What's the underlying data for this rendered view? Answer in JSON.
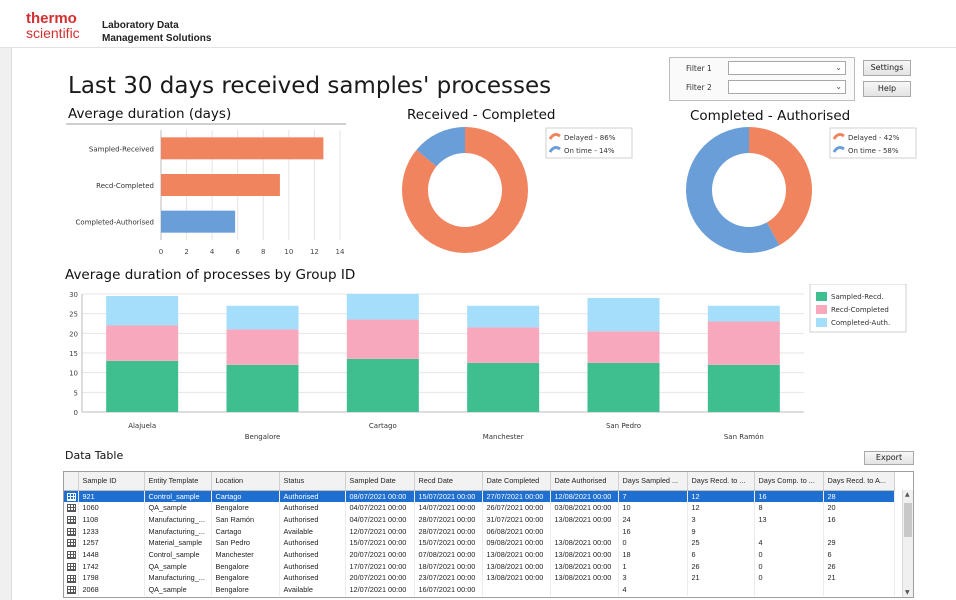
{
  "header": {
    "logo_line1": "thermo",
    "logo_line2": "scientific",
    "app_line1": "Laboratory Data",
    "app_line2": "Management Solutions"
  },
  "page_title": "Last 30 days received samples' processes",
  "filters": {
    "filter1_label": "Filter 1",
    "filter1_value": "",
    "filter2_label": "Filter 2",
    "filter2_value": "",
    "settings_label": "Settings",
    "help_label": "Help"
  },
  "colors": {
    "orange": "#f0845e",
    "blue": "#6a9ed8",
    "green": "#3fbf8f",
    "pink": "#f8a8bc",
    "lightblue": "#a4defa",
    "selection": "#1f6fd1"
  },
  "chart_data": [
    {
      "type": "bar",
      "orientation": "horizontal",
      "title": "Average duration (days)",
      "categories": [
        "Sampled-Received",
        "Recd-Completed",
        "Completed-Authorised"
      ],
      "values": [
        12.7,
        9.3,
        5.8
      ],
      "colors": [
        "#f0845e",
        "#f0845e",
        "#6a9ed8"
      ],
      "xlim": [
        0,
        14
      ],
      "xticks": [
        "0",
        "2",
        "4",
        "6",
        "8",
        "10",
        "12",
        "14"
      ],
      "grid": true
    },
    {
      "type": "pie",
      "style": "donut",
      "title": "Received - Completed",
      "slices": [
        {
          "label": "Delayed - 86%",
          "value": 86,
          "color": "#f0845e"
        },
        {
          "label": "On time - 14%",
          "value": 14,
          "color": "#6a9ed8"
        }
      ],
      "legend": "top-right"
    },
    {
      "type": "pie",
      "style": "donut",
      "title": "Completed - Authorised",
      "slices": [
        {
          "label": "Delayed - 42%",
          "value": 42,
          "color": "#f0845e"
        },
        {
          "label": "On time - 58%",
          "value": 58,
          "color": "#6a9ed8"
        }
      ],
      "legend": "top-right"
    },
    {
      "type": "bar",
      "stacked": true,
      "title": "Average duration of processes by Group ID",
      "categories": [
        "Alajuela",
        "Bengalore",
        "Cartago",
        "Manchester",
        "San Pedro",
        "San Ramón"
      ],
      "series": [
        {
          "name": "Sampled-Recd.",
          "values": [
            13,
            12,
            13.5,
            12.5,
            12.5,
            12
          ],
          "color": "#3fbf8f"
        },
        {
          "name": "Recd-Completed",
          "values": [
            9,
            9,
            10,
            9,
            8,
            11
          ],
          "color": "#f8a8bc"
        },
        {
          "name": "Completed-Auth.",
          "values": [
            7.5,
            6,
            6.5,
            5.5,
            8.5,
            4
          ],
          "color": "#a4defa"
        }
      ],
      "ylim": [
        0,
        30
      ],
      "yticks": [
        "0",
        "5",
        "10",
        "15",
        "20",
        "25",
        "30"
      ],
      "grid": true,
      "legend": "right"
    }
  ],
  "table": {
    "title": "Data Table",
    "export_label": "Export",
    "columns": [
      "Sample ID",
      "Entity Template",
      "Location",
      "Status",
      "Sampled Date",
      "Recd Date",
      "Date Completed",
      "Date Authorised",
      "Days Sampled ...",
      "Days Recd. to ...",
      "Days Comp. to ...",
      "Days Recd. to A..."
    ],
    "rows": [
      [
        "921",
        "Control_sample",
        "Cartago",
        "Authorised",
        "08/07/2021 00:00",
        "15/07/2021 00:00",
        "27/07/2021 00:00",
        "12/08/2021 00:00",
        "7",
        "12",
        "16",
        "28"
      ],
      [
        "1060",
        "QA_sample",
        "Bengalore",
        "Authorised",
        "04/07/2021 00:00",
        "14/07/2021 00:00",
        "26/07/2021 00:00",
        "03/08/2021 00:00",
        "10",
        "12",
        "8",
        "20"
      ],
      [
        "1108",
        "Manufacturing_...",
        "San Ramón",
        "Authorised",
        "04/07/2021 00:00",
        "28/07/2021 00:00",
        "31/07/2021 00:00",
        "13/08/2021 00:00",
        "24",
        "3",
        "13",
        "16"
      ],
      [
        "1233",
        "Manufacturing_...",
        "Cartago",
        "Available",
        "12/07/2021 00:00",
        "28/07/2021 00:00",
        "06/08/2021 00:00",
        "",
        "16",
        "9",
        "",
        ""
      ],
      [
        "1257",
        "Material_sample",
        "San Pedro",
        "Authorised",
        "15/07/2021 00:00",
        "15/07/2021 00:00",
        "09/08/2021 00:00",
        "13/08/2021 00:00",
        "0",
        "25",
        "4",
        "29"
      ],
      [
        "1448",
        "Control_sample",
        "Manchester",
        "Authorised",
        "20/07/2021 00:00",
        "07/08/2021 00:00",
        "13/08/2021 00:00",
        "13/08/2021 00:00",
        "18",
        "6",
        "0",
        "6"
      ],
      [
        "1742",
        "QA_sample",
        "Bengalore",
        "Authorised",
        "17/07/2021 00:00",
        "18/07/2021 00:00",
        "13/08/2021 00:00",
        "13/08/2021 00:00",
        "1",
        "26",
        "0",
        "26"
      ],
      [
        "1798",
        "Manufacturing_...",
        "Bengalore",
        "Authorised",
        "20/07/2021 00:00",
        "23/07/2021 00:00",
        "13/08/2021 00:00",
        "13/08/2021 00:00",
        "3",
        "21",
        "0",
        "21"
      ],
      [
        "2068",
        "QA_sample",
        "Bengalore",
        "Available",
        "12/07/2021 00:00",
        "16/07/2021 00:00",
        "",
        "",
        "4",
        "",
        "",
        ""
      ]
    ]
  }
}
